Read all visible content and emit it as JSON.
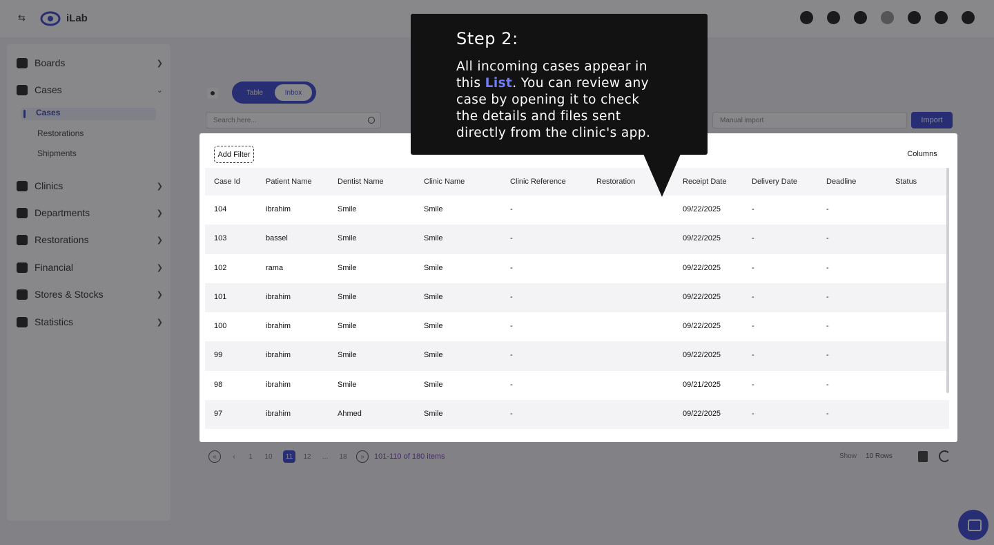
{
  "app": {
    "brand": "iLab"
  },
  "sidebar": {
    "items": [
      {
        "label": "Boards",
        "icon": "boards-icon"
      },
      {
        "label": "Cases",
        "icon": "cases-icon"
      },
      {
        "label": "Clinics",
        "icon": "clinics-icon"
      },
      {
        "label": "Departments",
        "icon": "departments-icon"
      },
      {
        "label": "Restorations",
        "icon": "tooth-icon"
      },
      {
        "label": "Financial",
        "icon": "dollar-icon"
      },
      {
        "label": "Stores & Stocks",
        "icon": "store-icon"
      },
      {
        "label": "Statistics",
        "icon": "chart-icon"
      }
    ],
    "subitems": [
      {
        "label": "Cases",
        "active": true
      },
      {
        "label": "Restorations"
      },
      {
        "label": "Shipments"
      }
    ]
  },
  "controls": {
    "view_toggle": [
      "Table",
      "Inbox"
    ],
    "search_placeholder": "Search here...",
    "manual_import_placeholder": "Manual import",
    "import_label": "Import"
  },
  "list": {
    "add_filter_label": "Add Filter",
    "columns_label": "Columns",
    "headers": [
      "Case Id",
      "Patient Name",
      "Dentist Name",
      "Clinic Name",
      "Clinic Reference",
      "Restoration",
      "Receipt Date",
      "Delivery Date",
      "Deadline",
      "Status"
    ],
    "rows": [
      [
        "104",
        "ibrahim",
        "Smile",
        "Smile",
        "-",
        "",
        "09/22/2025",
        "-",
        "-",
        ""
      ],
      [
        "103",
        "bassel",
        "Smile",
        "Smile",
        "-",
        "",
        "09/22/2025",
        "-",
        "-",
        ""
      ],
      [
        "102",
        "rama",
        "Smile",
        "Smile",
        "-",
        "",
        "09/22/2025",
        "-",
        "-",
        ""
      ],
      [
        "101",
        "ibrahim",
        "Smile",
        "Smile",
        "-",
        "",
        "09/22/2025",
        "-",
        "-",
        ""
      ],
      [
        "100",
        "ibrahim",
        "Smile",
        "Smile",
        "-",
        "",
        "09/22/2025",
        "-",
        "-",
        ""
      ],
      [
        "99",
        "ibrahim",
        "Smile",
        "Smile",
        "-",
        "",
        "09/22/2025",
        "-",
        "-",
        ""
      ],
      [
        "98",
        "ibrahim",
        "Smile",
        "Smile",
        "-",
        "",
        "09/21/2025",
        "-",
        "-",
        ""
      ],
      [
        "97",
        "ibrahim",
        "Ahmed",
        "Smile",
        "-",
        "",
        "09/22/2025",
        "-",
        "-",
        ""
      ]
    ]
  },
  "pager": {
    "pages": [
      "1",
      "...",
      "10",
      "11",
      "12",
      "...",
      "18"
    ],
    "summary": "101-110 of 180 items",
    "show_label": "Show",
    "rows_per_page": "10 Rows"
  },
  "tooltip": {
    "title": "Step 2:",
    "body_before": "All incoming cases appear in this ",
    "highlight": "List",
    "body_after": ". You can review any case by opening it to check the details and files sent directly from the clinic's app."
  },
  "colors": {
    "accent": "#3f4bd1",
    "highlight": "#6f7cff",
    "tooltip_bg": "#121212"
  }
}
